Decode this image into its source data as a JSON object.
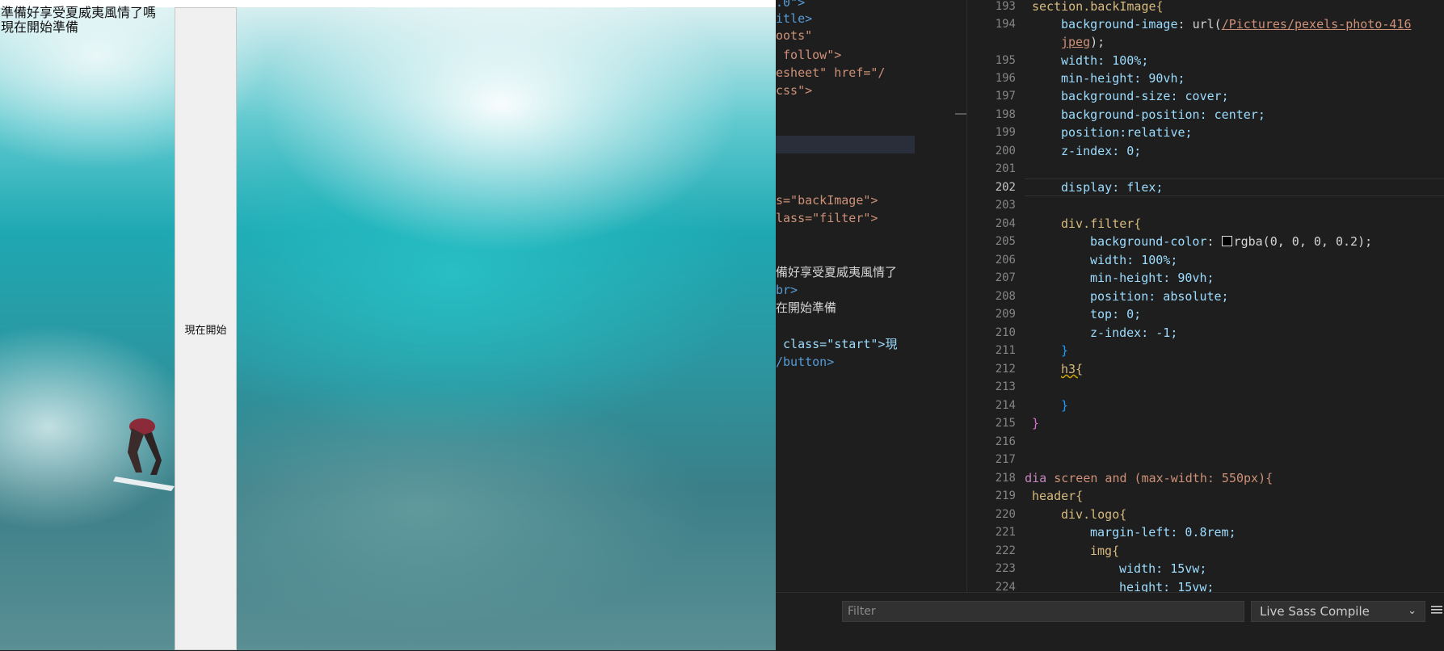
{
  "preview": {
    "line1": "準備好享受夏威夷風情了嗎",
    "line2": "現在開始準備",
    "button_label": "現在開始"
  },
  "left_pane": {
    "lines": [
      ".0\">",
      "itle>",
      "oots\"",
      " follow\">",
      "esheet\" href=\"/",
      "css\">",
      "",
      "",
      "",
      "",
      "s=\"backImage\">",
      "lass=\"filter\">",
      "",
      "",
      "備好享受夏威夷風情了",
      "br>",
      "在開始準備",
      "",
      " class=\"start\">現",
      "/button>"
    ]
  },
  "gutter": {
    "numbers": [
      "193",
      "194",
      "",
      "195",
      "196",
      "197",
      "198",
      "199",
      "200",
      "201",
      "202",
      "203",
      "204",
      "205",
      "206",
      "207",
      "208",
      "209",
      "210",
      "211",
      "212",
      "213",
      "214",
      "215",
      "216",
      "217",
      "218",
      "219",
      "220",
      "221",
      "222",
      "223",
      "224"
    ],
    "active": "202"
  },
  "code": {
    "l193": "section.backImage{",
    "l194_prop": "background-image",
    "l194_fn": "url(",
    "l194_url": "/Pictures/pexels-photo-416",
    "l194b_url": "jpeg",
    "l194b_tail": ");",
    "l195": "width: 100%;",
    "l196": "min-height: 90vh;",
    "l197": "background-size: cover;",
    "l198": "background-position: center;",
    "l199": "position:relative;",
    "l200": "z-index: 0;",
    "l202": "display: flex;",
    "l204": "div.filter{",
    "l205_prop": "background-color",
    "l205_val": "rgba(0, 0, 0, 0.2);",
    "l206": "width: 100%;",
    "l207": "min-height: 90vh;",
    "l208": "position: absolute;",
    "l209": "top: 0;",
    "l210": "z-index: -1;",
    "l211": "}",
    "l212": "h3{",
    "l214": "}",
    "l215": "}",
    "l216": "}",
    "l218_kw": "@media",
    "l218_rest": "screen and (max-width: 550px){",
    "l219": "header{",
    "l220": "div.logo{",
    "l221": "margin-left: 0.8rem;",
    "l222": "img{",
    "l223": "width: 15vw;",
    "l224": "height: 15vw;"
  },
  "bottom": {
    "filter_placeholder": "Filter",
    "output_channel": "Live Sass Compile"
  },
  "icons": [
    "chevron-down-icon",
    "list-icon"
  ]
}
